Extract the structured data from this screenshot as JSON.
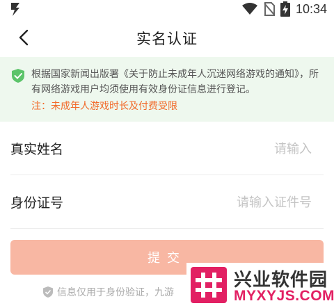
{
  "status_bar": {
    "time": "10:34"
  },
  "nav": {
    "title": "实名认证"
  },
  "notice": {
    "text": "根据国家新闻出版署《关于防止未成年人沉迷网络游戏的通知》，所有网络游戏用户均须使用有效身份证信息进行登记。",
    "warning": "注：未成年人游戏时长及付费受限"
  },
  "form": {
    "name_label": "真实姓名",
    "name_placeholder": "请输入",
    "id_label": "身份证号",
    "id_placeholder": "请输入证件号"
  },
  "submit_label": "提交",
  "footer_note": "信息仅用于身份验证，九游",
  "watermark": {
    "title": "兴业软件园",
    "url": "MYXYJS.COM"
  },
  "colors": {
    "accent": "#f8b7a3",
    "warning": "#f26a2a",
    "notice_bg": "#eef8ee",
    "shield": "#5cc46a",
    "watermark_brand": "#e22063"
  }
}
